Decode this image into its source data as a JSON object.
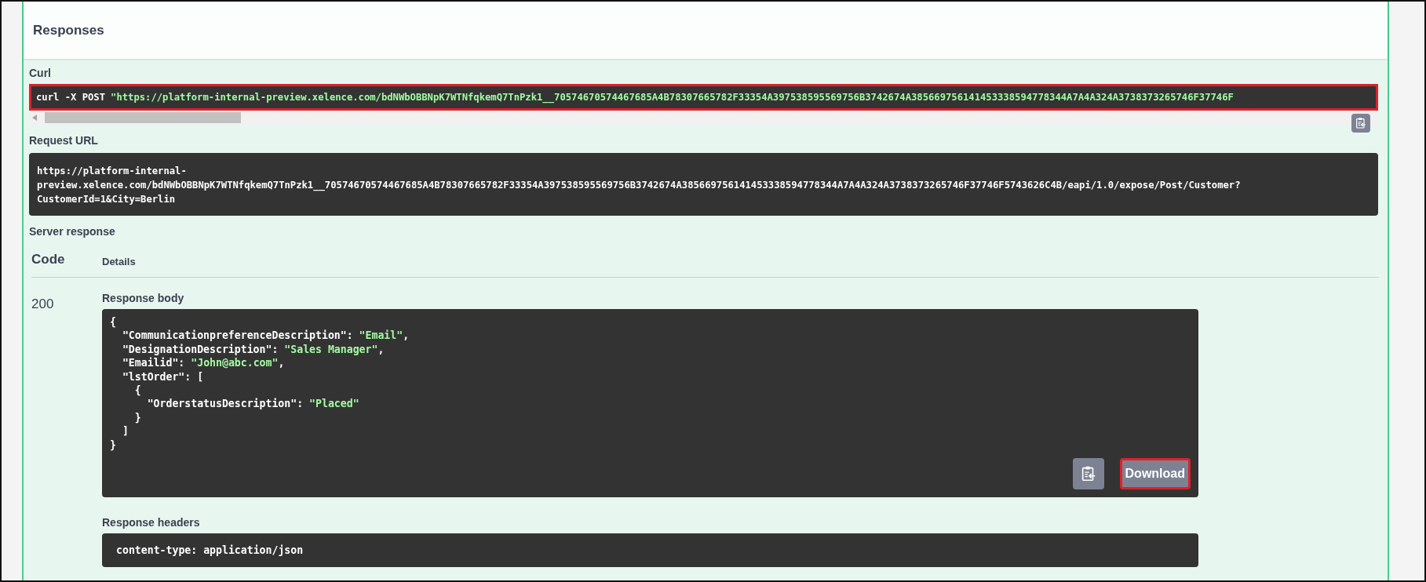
{
  "section": {
    "title": "Responses"
  },
  "curl": {
    "label": "Curl",
    "command": "curl -X POST",
    "url": "\"https://platform-internal-preview.xelence.com/bdNWbOBBNpK7WTNfqkemQ7TnPzk1__70574670574467685A4B78307665782F33354A397538595569756B3742674A385669756141453338594778344A7A4A324A3738373265746F37746F",
    "highlighted": true
  },
  "request_url": {
    "label": "Request URL",
    "value": "https://platform-internal-preview.xelence.com/bdNWbOBBNpK7WTNfqkemQ7TnPzk1__70574670574467685A4B78307665782F33354A397538595569756B3742674A385669756141453338594778344A7A4A324A3738373265746F37746F5743626C4B/eapi/1.0/expose/Post/Customer?CustomerId=1&City=Berlin"
  },
  "server_response": {
    "label": "Server response",
    "columns": [
      "Code",
      "Details"
    ],
    "code": "200",
    "body_label": "Response body",
    "body_lines": [
      "{",
      "  \"CommunicationpreferenceDescription\": \"Email\",",
      "  \"DesignationDescription\": \"Sales Manager\",",
      "  \"Emailid\": \"John@abc.com\",",
      "  \"lstOrder\": [",
      "    {",
      "      \"OrderstatusDescription\": \"Placed\"",
      "    }",
      "  ]",
      "}"
    ],
    "download": {
      "label": "Download",
      "highlighted": true
    },
    "headers_label": "Response headers",
    "headers": "content-type: application/json"
  }
}
